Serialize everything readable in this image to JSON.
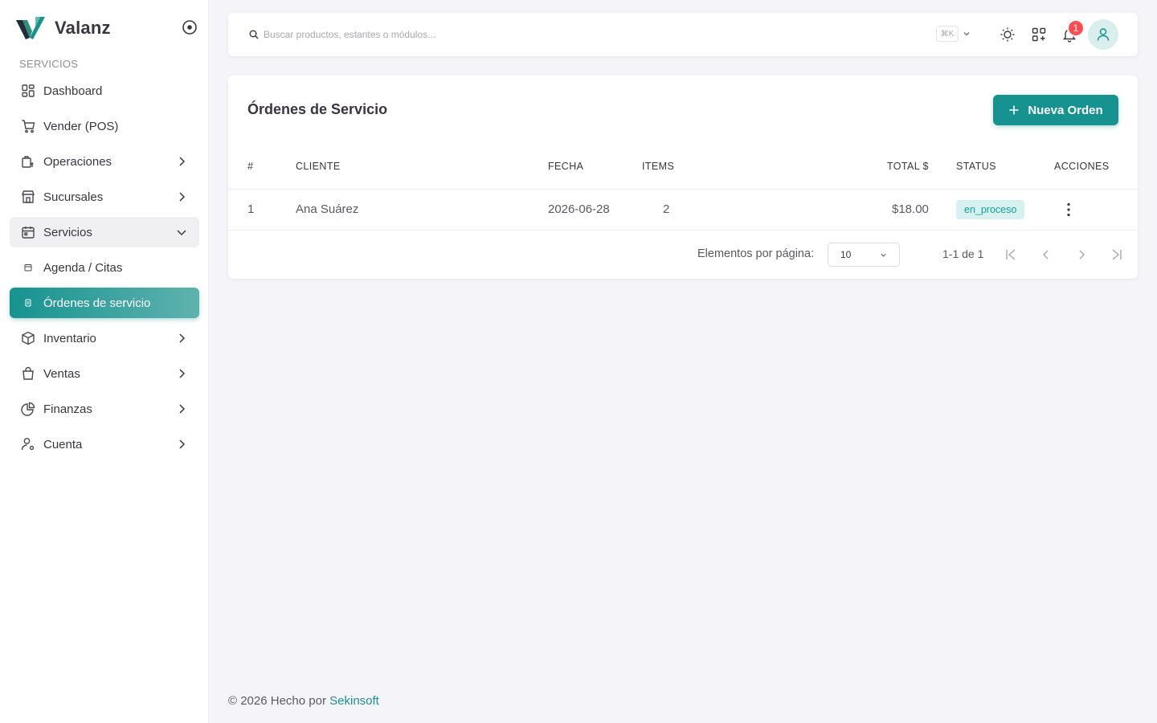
{
  "brand": {
    "name": "Valanz",
    "logo_icon": "v-logo-icon",
    "accent": "#169390"
  },
  "sidebar": {
    "section_label": "SERVICIOS",
    "items": [
      {
        "label": "Dashboard",
        "icon": "dashboard-grid-icon"
      },
      {
        "label": "Vender (POS)",
        "icon": "cart-icon"
      },
      {
        "label": "Operaciones",
        "icon": "operations-icon"
      },
      {
        "label": "Sucursales",
        "icon": "store-icon"
      },
      {
        "label": "Servicios",
        "icon": "calendar-icon"
      },
      {
        "label": "Agenda / Citas",
        "icon": "agenda-icon"
      },
      {
        "label": "Órdenes de servicio",
        "icon": "order-icon"
      },
      {
        "label": "Inventario",
        "icon": "box-icon"
      },
      {
        "label": "Ventas",
        "icon": "bag-icon"
      },
      {
        "label": "Finanzas",
        "icon": "pie-chart-icon"
      },
      {
        "label": "Cuenta",
        "icon": "user-settings-icon"
      }
    ],
    "active_item": "Órdenes de servicio",
    "open_item": "Servicios"
  },
  "topbar": {
    "search_placeholder": "Buscar productos, estantes o módulos...",
    "shortcut": "⌘K",
    "notification_count": "1"
  },
  "orders": {
    "title": "Órdenes de Servicio",
    "new_button": "Nueva Orden",
    "columns": [
      "#",
      "CLIENTE",
      "FECHA",
      "ITEMS",
      "TOTAL $",
      "STATUS",
      "ACCIONES"
    ],
    "rows": [
      {
        "num": "1",
        "cliente": "Ana Suárez",
        "fecha": "2026-06-28",
        "items": "2",
        "total": "$18.00",
        "status": "en_proceso"
      }
    ],
    "pagination": {
      "per_page_label": "Elementos por página:",
      "per_page_value": "10",
      "range": "1-1 de 1"
    }
  },
  "footer": {
    "text": "© 2026 Hecho por ",
    "link": "Sekinsoft"
  }
}
